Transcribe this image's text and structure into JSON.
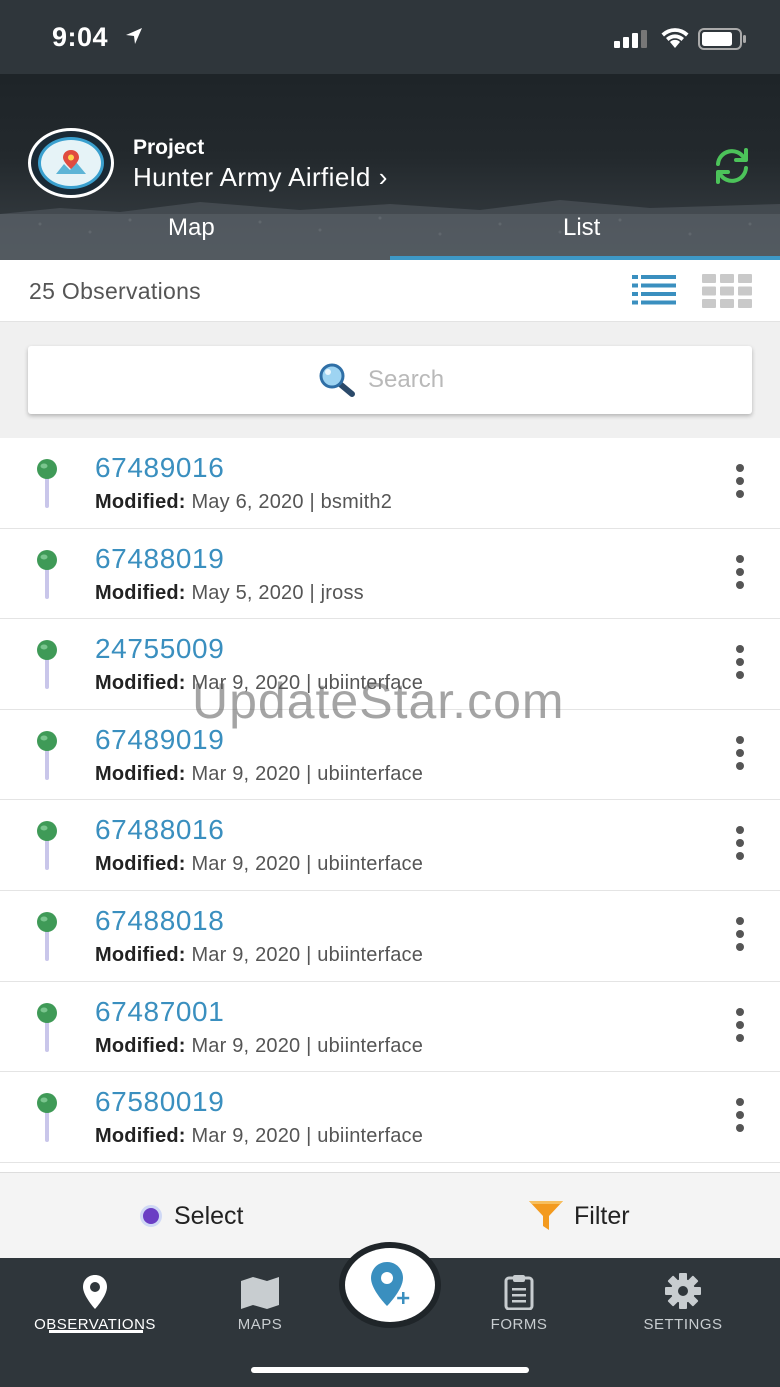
{
  "status_bar": {
    "time": "9:04"
  },
  "header": {
    "project_label": "Project",
    "project_name": "Hunter Army Airfield",
    "tabs": [
      {
        "label": "Map",
        "active": false
      },
      {
        "label": "List",
        "active": true
      }
    ],
    "accent_color": "#3e98c6"
  },
  "toolbar": {
    "observation_count": "25 Observations",
    "view_modes": [
      "list-view-icon",
      "grid-view-icon"
    ]
  },
  "search": {
    "placeholder": "Search"
  },
  "observations": [
    {
      "id": "67489016",
      "modified_label": "Modified:",
      "modified": "May 6, 2020 | bsmith2"
    },
    {
      "id": "67488019",
      "modified_label": "Modified:",
      "modified": "May 5, 2020 | jross"
    },
    {
      "id": "24755009",
      "modified_label": "Modified:",
      "modified": "Mar 9, 2020 | ubiinterface"
    },
    {
      "id": "67489019",
      "modified_label": "Modified:",
      "modified": "Mar 9, 2020 | ubiinterface"
    },
    {
      "id": "67488016",
      "modified_label": "Modified:",
      "modified": "Mar 9, 2020 | ubiinterface"
    },
    {
      "id": "67488018",
      "modified_label": "Modified:",
      "modified": "Mar 9, 2020 | ubiinterface"
    },
    {
      "id": "67487001",
      "modified_label": "Modified:",
      "modified": "Mar 9, 2020 | ubiinterface"
    },
    {
      "id": "67580019",
      "modified_label": "Modified:",
      "modified": "Mar 9, 2020 | ubiinterface"
    }
  ],
  "watermark": "UpdateStar.com",
  "actions": {
    "select_label": "Select",
    "filter_label": "Filter"
  },
  "nav": {
    "observations": "OBSERVATIONS",
    "maps": "MAPS",
    "forms": "FORMS",
    "settings": "SETTINGS"
  }
}
